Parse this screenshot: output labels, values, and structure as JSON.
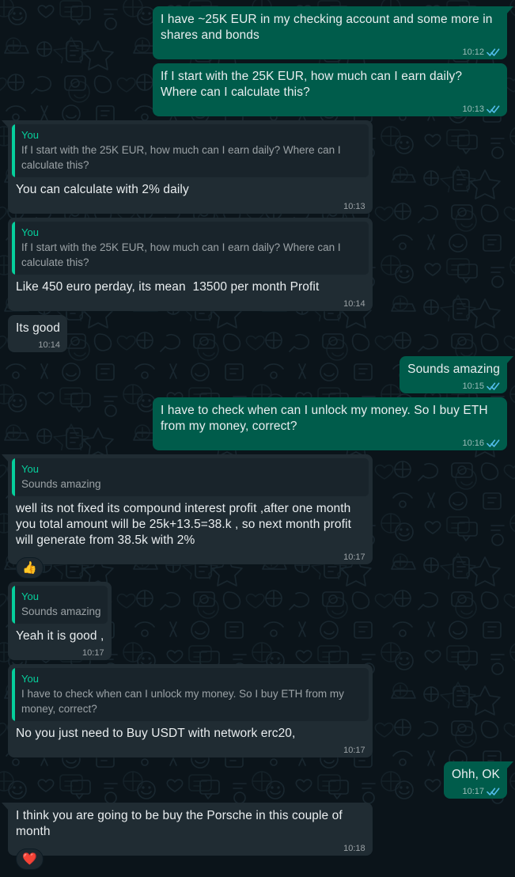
{
  "app": {
    "name": "WhatsApp",
    "theme": "dark",
    "colors": {
      "background": "#0b141a",
      "outgoing_bubble": "#005c4b",
      "incoming_bubble": "#202c33",
      "quote_accent": "#06cf9c",
      "read_tick": "#53bdeb",
      "text": "#e9edef"
    }
  },
  "quote_author_label": "You",
  "messages": [
    {
      "id": "m1",
      "direction": "outgoing",
      "tail": true,
      "text": "I have ~25K EUR in my checking account and some more in shares and bonds",
      "time": "10:12",
      "status": "read"
    },
    {
      "id": "m2",
      "direction": "outgoing",
      "tail": false,
      "text": "If I start with the 25K EUR, how much can I earn daily? Where can I calculate this?",
      "time": "10:13",
      "status": "read"
    },
    {
      "id": "m3",
      "direction": "incoming",
      "tail": true,
      "quote": {
        "author": "You",
        "text": "If I start with the 25K EUR, how much can I earn daily? Where can I calculate this?"
      },
      "text": "You can calculate with 2% daily",
      "time": "10:13"
    },
    {
      "id": "m4",
      "direction": "incoming",
      "tail": false,
      "quote": {
        "author": "You",
        "text": "If I start with the 25K EUR, how much can I earn daily? Where can I calculate this?"
      },
      "text": "Like 450 euro perday, its mean  13500 per month Profit",
      "time": "10:14"
    },
    {
      "id": "m5",
      "direction": "incoming",
      "tail": false,
      "text": "Its good",
      "time": "10:14"
    },
    {
      "id": "m6",
      "direction": "outgoing",
      "tail": true,
      "text": "Sounds amazing",
      "time": "10:15",
      "status": "read"
    },
    {
      "id": "m7",
      "direction": "outgoing",
      "tail": false,
      "text": "I have to check when can I unlock my money. So I buy ETH from my money, correct?",
      "time": "10:16",
      "status": "read"
    },
    {
      "id": "m8",
      "direction": "incoming",
      "tail": true,
      "quote": {
        "author": "You",
        "text": "Sounds amazing"
      },
      "text": "well its not fixed its compound interest profit ,after one month you total amount will be 25k+13.5=38.k , so next month profit will generate from 38.5k with 2%",
      "time": "10:17",
      "reaction": "👍"
    },
    {
      "id": "m9",
      "direction": "incoming",
      "tail": false,
      "quote": {
        "author": "You",
        "text": "Sounds amazing"
      },
      "text": "Yeah it is good ,",
      "time": "10:17"
    },
    {
      "id": "m10",
      "direction": "incoming",
      "tail": false,
      "quote": {
        "author": "You",
        "text": "I have to check when can I unlock my money. So I buy ETH from my money, correct?"
      },
      "text": "No you just need to Buy USDT with network erc20,",
      "time": "10:17"
    },
    {
      "id": "m11",
      "direction": "outgoing",
      "tail": true,
      "text": "Ohh, OK",
      "time": "10:17",
      "status": "read"
    },
    {
      "id": "m12",
      "direction": "incoming",
      "tail": true,
      "text": "I think you are going to be buy the Porsche in this couple of month",
      "time": "10:18",
      "reaction": "❤️"
    }
  ]
}
